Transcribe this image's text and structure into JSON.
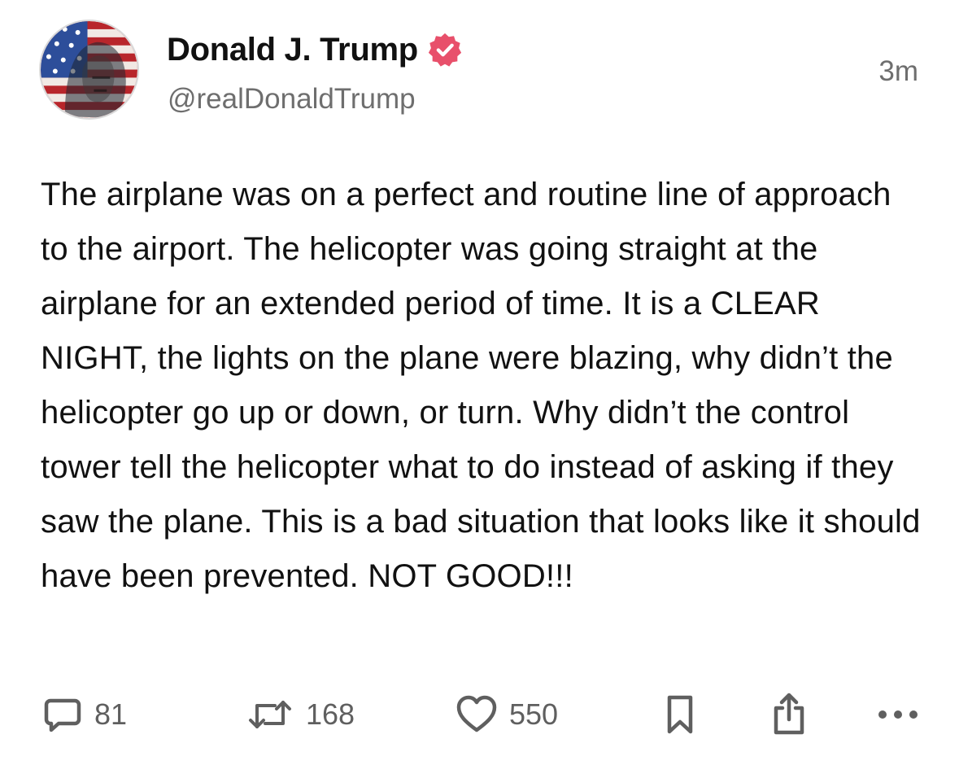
{
  "author": {
    "display_name": "Donald J. Trump",
    "handle": "@realDonaldTrump",
    "avatar_icon": "flag-portrait-avatar",
    "verified_icon": "verified-badge-icon",
    "verified_color": "#e8506b"
  },
  "timestamp": "3m",
  "post": {
    "text": "The airplane was on a perfect and routine line of approach to the airport. The helicopter was going straight at the airplane for an extended period of time. It is a CLEAR NIGHT, the lights on the plane were blazing, why didn’t the helicopter go up or down, or turn. Why didn’t the control tower tell the helicopter what to do instead of asking if they saw the plane. This is a bad situation that looks like it should have been prevented. NOT GOOD!!!"
  },
  "actions": {
    "reply": {
      "icon": "reply-icon",
      "count": "81"
    },
    "retruth": {
      "icon": "repost-icon",
      "count": "168"
    },
    "like": {
      "icon": "heart-icon",
      "count": "550"
    },
    "bookmark": {
      "icon": "bookmark-icon"
    },
    "share": {
      "icon": "share-icon"
    },
    "more": {
      "icon": "more-icon"
    }
  },
  "colors": {
    "text": "#111111",
    "secondary": "#6e6e6e",
    "icon": "#5f5f5f",
    "accent": "#e8506b"
  }
}
